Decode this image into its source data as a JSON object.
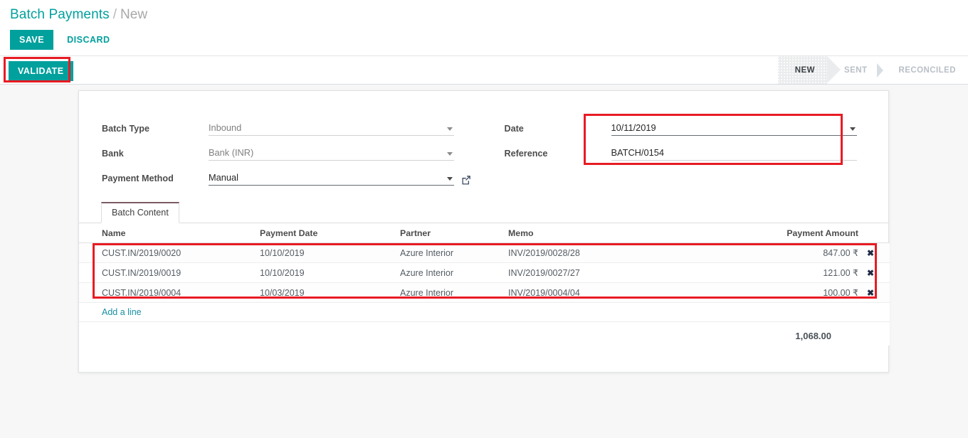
{
  "breadcrumb": {
    "root": "Batch Payments",
    "separator": "/",
    "current": "New"
  },
  "toolbar": {
    "save_label": "SAVE",
    "discard_label": "DISCARD",
    "validate_label": "VALIDATE"
  },
  "statusbar": {
    "stages": [
      {
        "label": "NEW",
        "active": true
      },
      {
        "label": "SENT",
        "active": false
      },
      {
        "label": "RECONCILED",
        "active": false
      }
    ]
  },
  "form": {
    "left": [
      {
        "label": "Batch Type",
        "value": "Inbound",
        "widget": "dropdown",
        "muted": true
      },
      {
        "label": "Bank",
        "value": "Bank (INR)",
        "widget": "dropdown",
        "muted": true
      },
      {
        "label": "Payment Method",
        "value": "Manual",
        "widget": "dropdown-link",
        "muted": false
      }
    ],
    "right": [
      {
        "label": "Date",
        "value": "10/11/2019",
        "widget": "dropdown",
        "muted": false
      },
      {
        "label": "Reference",
        "value": "BATCH/0154",
        "widget": "text",
        "muted": false
      }
    ]
  },
  "notebook": {
    "tabs": [
      {
        "label": "Batch Content",
        "active": true
      }
    ]
  },
  "table": {
    "columns": [
      "Name",
      "Payment Date",
      "Partner",
      "Memo",
      "Payment Amount"
    ],
    "rows": [
      {
        "name": "CUST.IN/2019/0020",
        "payment_date": "10/10/2019",
        "partner": "Azure Interior",
        "memo": "INV/2019/0028/28",
        "amount": "847.00 ₹",
        "delete_icon": "✖"
      },
      {
        "name": "CUST.IN/2019/0019",
        "payment_date": "10/10/2019",
        "partner": "Azure Interior",
        "memo": "INV/2019/0027/27",
        "amount": "121.00 ₹",
        "delete_icon": "✖"
      },
      {
        "name": "CUST.IN/2019/0004",
        "payment_date": "10/03/2019",
        "partner": "Azure Interior",
        "memo": "INV/2019/0004/04",
        "amount": "100.00 ₹",
        "delete_icon": "✖"
      }
    ],
    "add_line_label": "Add a line",
    "total": "1,068.00"
  },
  "colors": {
    "accent": "#00A09D",
    "link": "#1a8fa3",
    "highlight": "#e81b23",
    "background": "#f7f7f7"
  }
}
